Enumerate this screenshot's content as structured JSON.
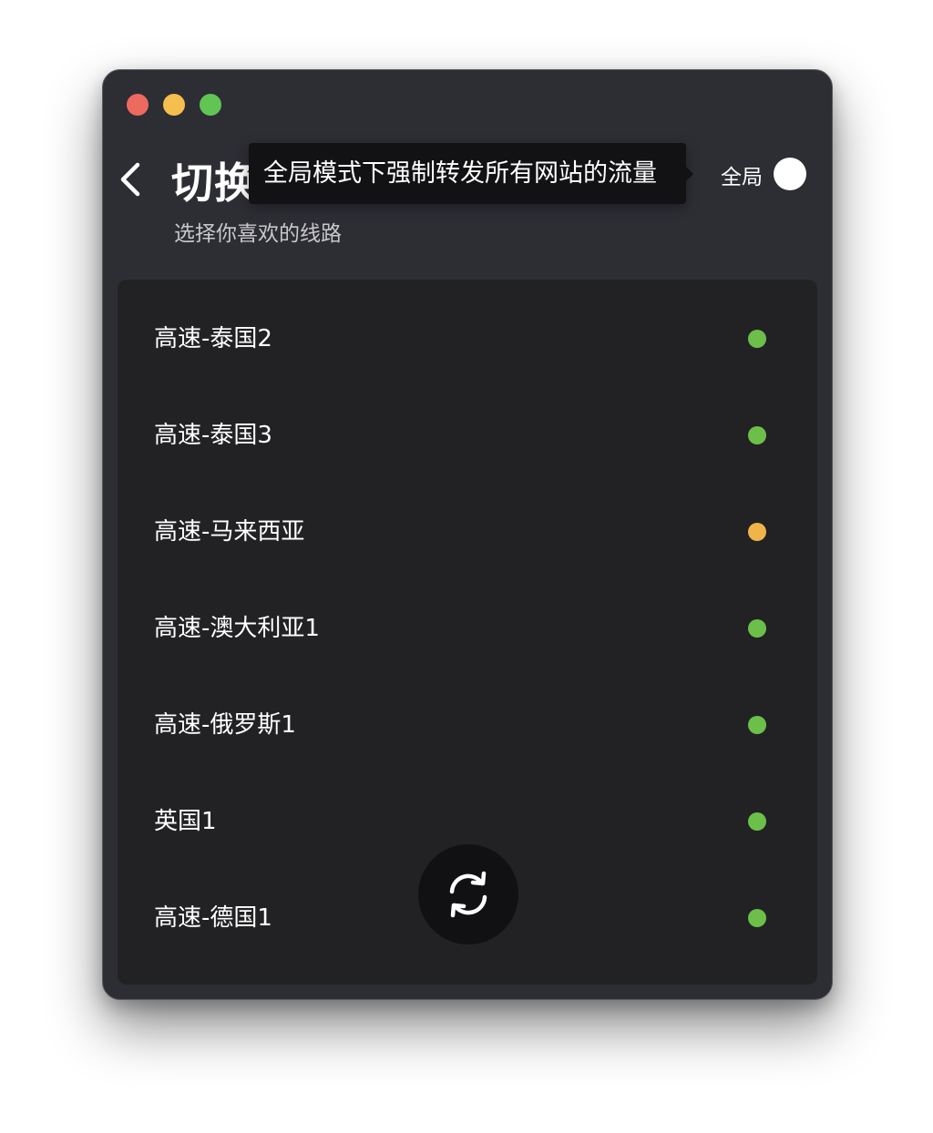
{
  "window_controls": {
    "close_color": "#ed6a5e",
    "minimize_color": "#f5bf4f",
    "maximize_color": "#61c554"
  },
  "header": {
    "back_icon": "chevron-left-icon",
    "title": "切换线路",
    "subtitle": "选择你喜欢的线路",
    "tooltip": "全局模式下强制转发所有网站的流量",
    "global_label": "全局"
  },
  "routes": [
    {
      "name": "高速-泰国2",
      "status_color": "#6cc04a"
    },
    {
      "name": "高速-泰国3",
      "status_color": "#6cc04a"
    },
    {
      "name": "高速-马来西亚",
      "status_color": "#f0b44a"
    },
    {
      "name": "高速-澳大利亚1",
      "status_color": "#6cc04a"
    },
    {
      "name": "高速-俄罗斯1",
      "status_color": "#6cc04a"
    },
    {
      "name": "英国1",
      "status_color": "#6cc04a"
    },
    {
      "name": "高速-德国1",
      "status_color": "#6cc04a"
    }
  ],
  "refresh_icon": "refresh-icon"
}
